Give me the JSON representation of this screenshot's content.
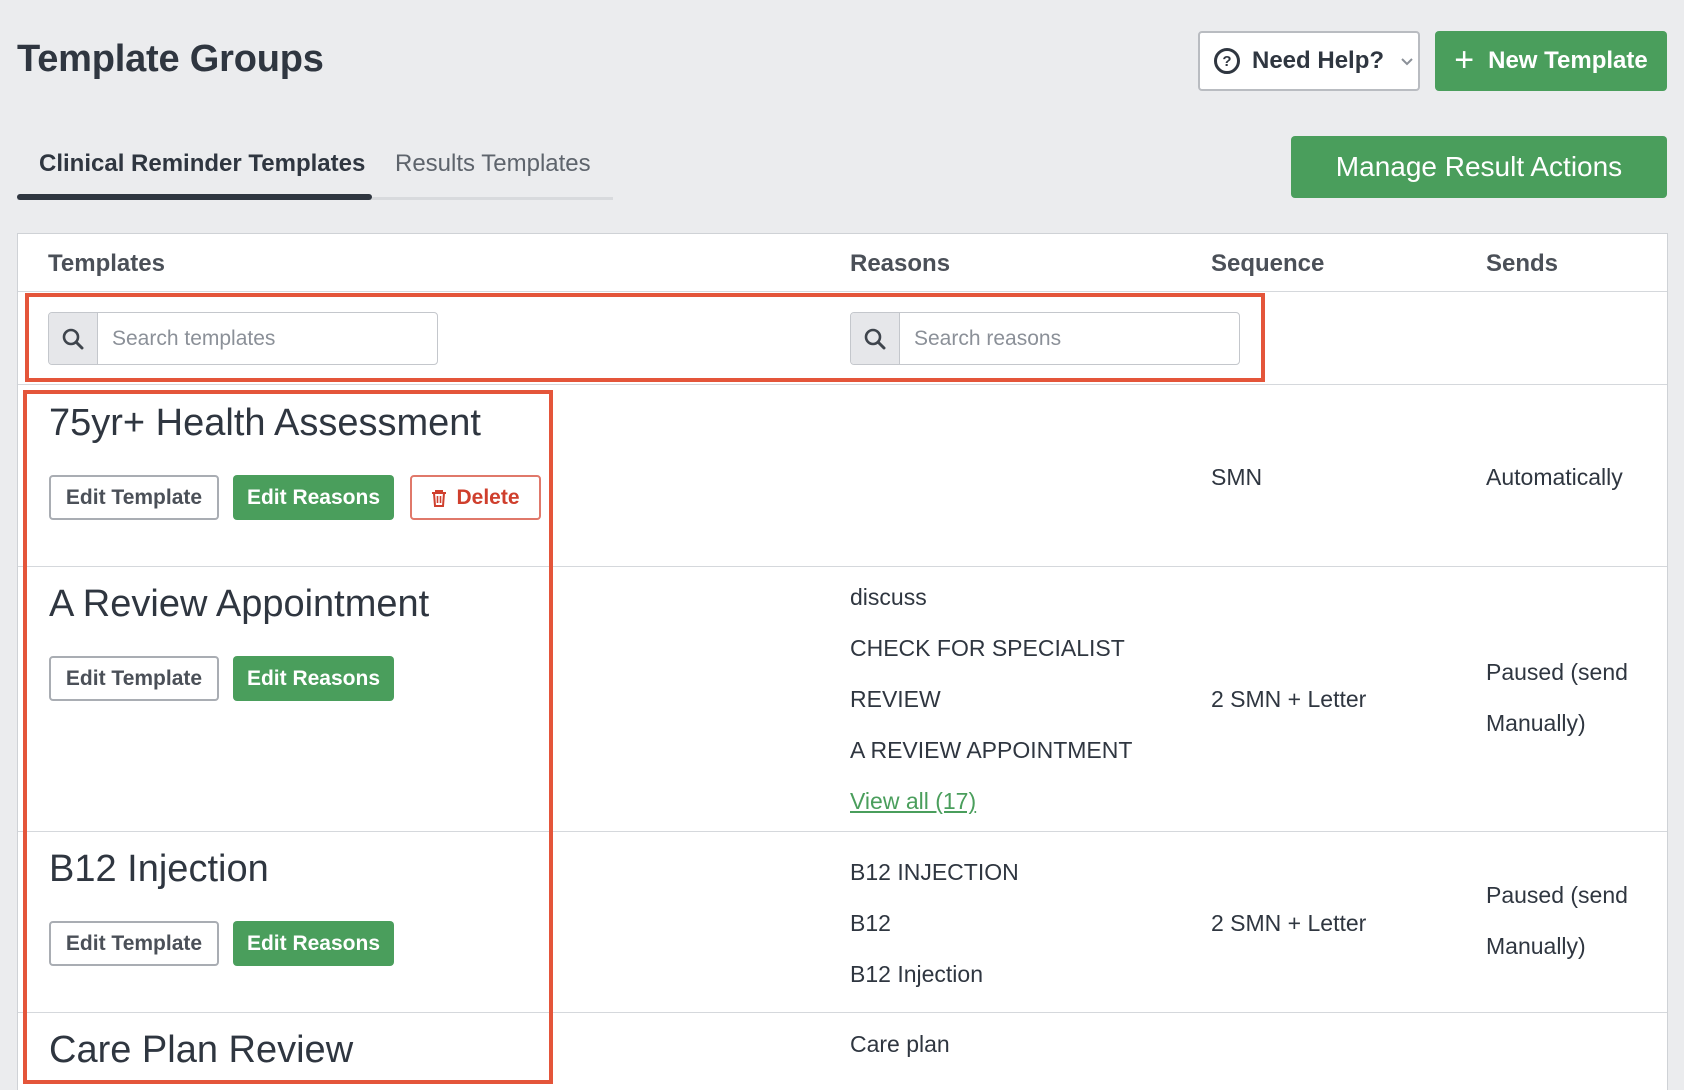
{
  "header": {
    "title": "Template Groups",
    "help_label": "Need Help?",
    "new_template_label": "New Template"
  },
  "tabs": [
    {
      "label": "Clinical Reminder Templates",
      "active": true
    },
    {
      "label": "Results Templates",
      "active": false
    }
  ],
  "manage_result_actions_label": "Manage Result Actions",
  "table": {
    "columns": [
      "Templates",
      "Reasons",
      "Sequence",
      "Sends"
    ],
    "search_templates_placeholder": "Search templates",
    "search_reasons_placeholder": "Search reasons",
    "rows": [
      {
        "name": "75yr+ Health Assessment",
        "edit_template_label": "Edit Template",
        "edit_reasons_label": "Edit Reasons",
        "delete_label": "Delete",
        "reasons": [],
        "sequence": "SMN",
        "sends": "Automatically"
      },
      {
        "name": "A Review Appointment",
        "edit_template_label": "Edit Template",
        "edit_reasons_label": "Edit Reasons",
        "reasons": [
          "discuss",
          "CHECK FOR SPECIALIST",
          "REVIEW",
          "A REVIEW APPOINTMENT"
        ],
        "view_all_label": "View all (17)",
        "sequence": "2 SMN + Letter",
        "sends_line1": "Paused (send",
        "sends_line2": "Manually)"
      },
      {
        "name": "B12 Injection",
        "edit_template_label": "Edit Template",
        "edit_reasons_label": "Edit Reasons",
        "reasons": [
          "B12 INJECTION",
          "B12",
          "B12 Injection"
        ],
        "sequence": "2 SMN + Letter",
        "sends_line1": "Paused (send",
        "sends_line2": "Manually)"
      },
      {
        "name": "Care Plan Review",
        "reasons": [
          "Care plan"
        ]
      }
    ]
  },
  "colors": {
    "accent_green": "#4a9e5c",
    "delete_red": "#cf3f2d",
    "highlight_orange": "#e4553a",
    "page_bg": "#ebecee"
  },
  "icons": [
    "question-circle-icon",
    "chevron-down-icon",
    "plus-icon",
    "search-icon",
    "trash-icon"
  ]
}
